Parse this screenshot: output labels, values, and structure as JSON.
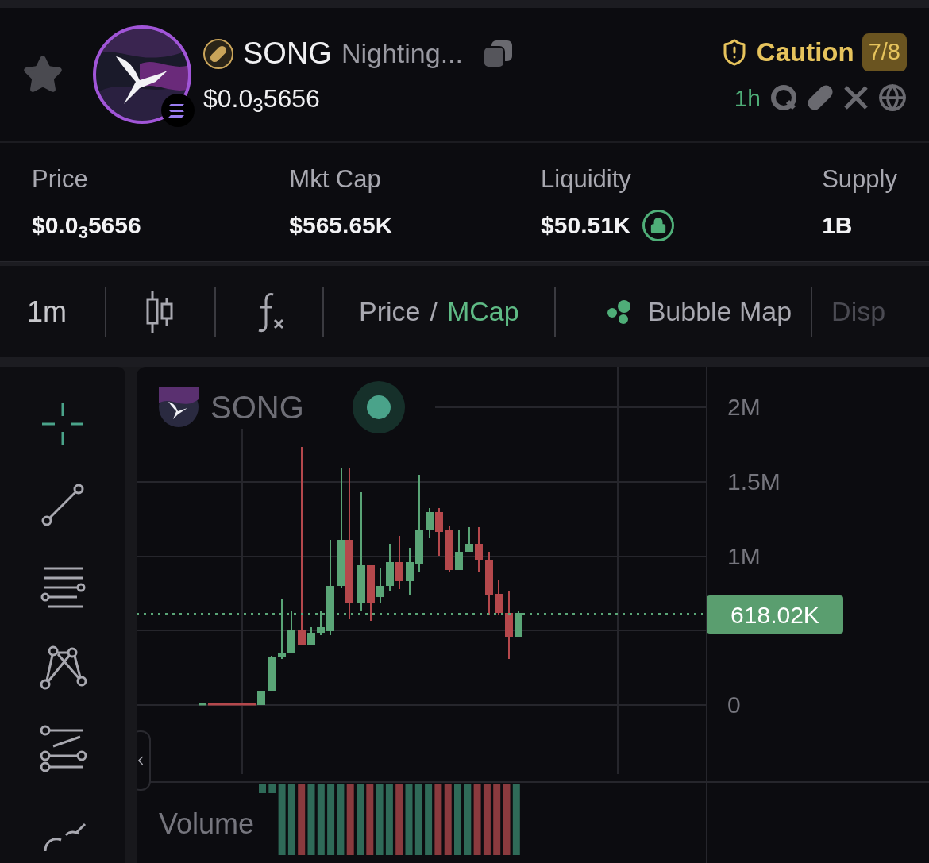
{
  "token": {
    "symbol": "SONG",
    "name": "Nighting...",
    "price": "$0.0$_{3}$5656",
    "favorite": false
  },
  "risk": {
    "label": "Caution",
    "score": "7/8"
  },
  "age": "1h",
  "stats": [
    {
      "label": "Price",
      "value": "$0.0$_{3}$5656"
    },
    {
      "label": "Mkt Cap",
      "value": "$565.65K"
    },
    {
      "label": "Liquidity",
      "value": "$50.51K",
      "locked": true
    },
    {
      "label": "Supply",
      "value": "1B"
    }
  ],
  "toolbar": {
    "interval": "1m",
    "modes": [
      {
        "label": "Price",
        "selected": false
      },
      {
        "label": "MCap",
        "selected": true
      }
    ],
    "separator": "/",
    "bubble_map": "Bubble Map",
    "cut_off": "Disp"
  },
  "tools": [
    {
      "kind": "crosshair",
      "selected": true
    },
    {
      "kind": "line",
      "selected": false
    },
    {
      "kind": "hlines",
      "selected": false
    },
    {
      "kind": "pattern",
      "selected": false
    },
    {
      "kind": "channel",
      "selected": false
    },
    {
      "kind": "brush",
      "selected": false
    }
  ],
  "chart": {
    "symbol": "SONG",
    "live": true,
    "y_ticks": [
      "2M",
      "1.5M",
      "1M",
      "0"
    ],
    "last_value": "618.02K",
    "volume_label": "Volume"
  }
}
